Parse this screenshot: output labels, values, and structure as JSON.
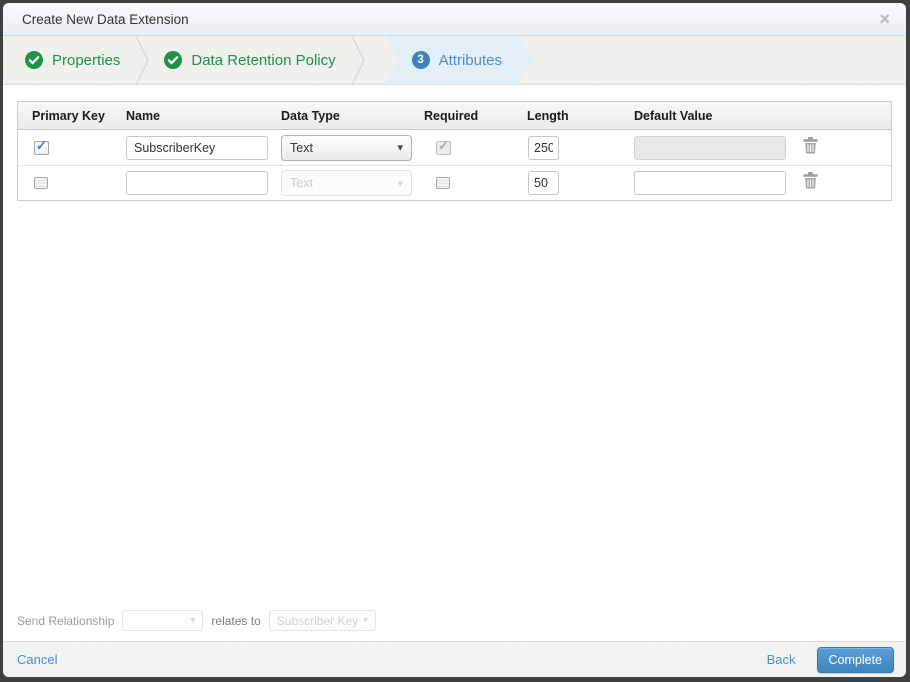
{
  "dialog": {
    "title": "Create New Data Extension"
  },
  "icons": {
    "close": "×",
    "caret_down": "▾"
  },
  "wizard": {
    "steps": [
      {
        "label": "Properties",
        "status": "complete"
      },
      {
        "label": "Data Retention Policy",
        "status": "complete"
      },
      {
        "label": "Attributes",
        "status": "active",
        "number": "3"
      }
    ]
  },
  "table": {
    "headers": [
      "Primary Key",
      "Name",
      "Data Type",
      "Required",
      "Length",
      "Default Value"
    ],
    "rows": [
      {
        "primary_key": true,
        "name": "SubscriberKey",
        "data_type": "Text",
        "required": true,
        "length": "250",
        "default_value": "",
        "default_disabled": true
      },
      {
        "primary_key": false,
        "name": "",
        "data_type": "Text",
        "required": false,
        "length": "50",
        "default_value": "",
        "default_disabled": false
      }
    ]
  },
  "send_relationship": {
    "label": "Send Relationship",
    "relates_to_label": "relates to",
    "target_value": "Subscriber Key"
  },
  "footer": {
    "cancel_label": "Cancel",
    "back_label": "Back",
    "complete_label": "Complete"
  },
  "colors": {
    "accent_blue": "#4a90c8",
    "success_green": "#21914b",
    "active_step_bg": "#e4eef7",
    "surround_dark": "#3e4041"
  }
}
